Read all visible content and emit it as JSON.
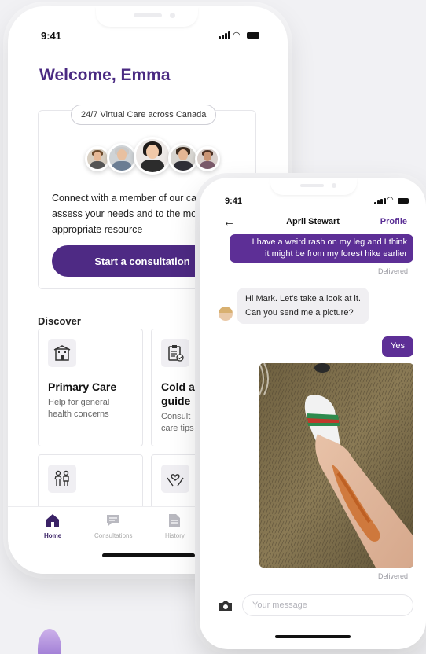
{
  "phone_home": {
    "status_time": "9:41",
    "welcome": "Welcome, Emma",
    "care_pill": "24/7 Virtual Care across Canada",
    "connect_text": "Connect with a member of our ca who will assess your needs and to the most appropriate resource",
    "start_button": "Start a consultation",
    "discover_heading": "Discover",
    "tiles": [
      {
        "title": "Primary Care",
        "desc": "Help for general health concerns",
        "icon": "hospital-icon"
      },
      {
        "title": "Cold a guide",
        "desc": "Consult care tips",
        "icon": "clipboard-icon"
      },
      {
        "title": "",
        "desc": "",
        "icon": "family-icon"
      },
      {
        "title": "",
        "desc": "",
        "icon": "heart-hands-icon"
      }
    ],
    "tabs": [
      {
        "label": "Home",
        "icon": "home-icon",
        "active": true
      },
      {
        "label": "Consultations",
        "icon": "chat-icon",
        "active": false
      },
      {
        "label": "History",
        "icon": "document-icon",
        "active": false
      }
    ]
  },
  "phone_chat": {
    "status_time": "9:41",
    "contact_name": "April Stewart",
    "profile_link": "Profile",
    "messages": [
      {
        "from": "me",
        "text_line1": "I have a weird rash on my leg and I think",
        "text_line2": "it might be from my forest hike earlier",
        "status": "Delivered"
      },
      {
        "from": "them",
        "text_line1": "Hi Mark. Let's take a look at it.",
        "text_line2": "Can you send me a picture?"
      },
      {
        "from": "me",
        "text_line1": "Yes"
      },
      {
        "from": "me",
        "type": "photo",
        "status": "Delivered"
      }
    ],
    "composer_placeholder": "Your message"
  },
  "colors": {
    "brand_purple": "#4e2a84",
    "bubble_purple": "#5d2f96",
    "bubble_gray": "#f0eff2"
  }
}
